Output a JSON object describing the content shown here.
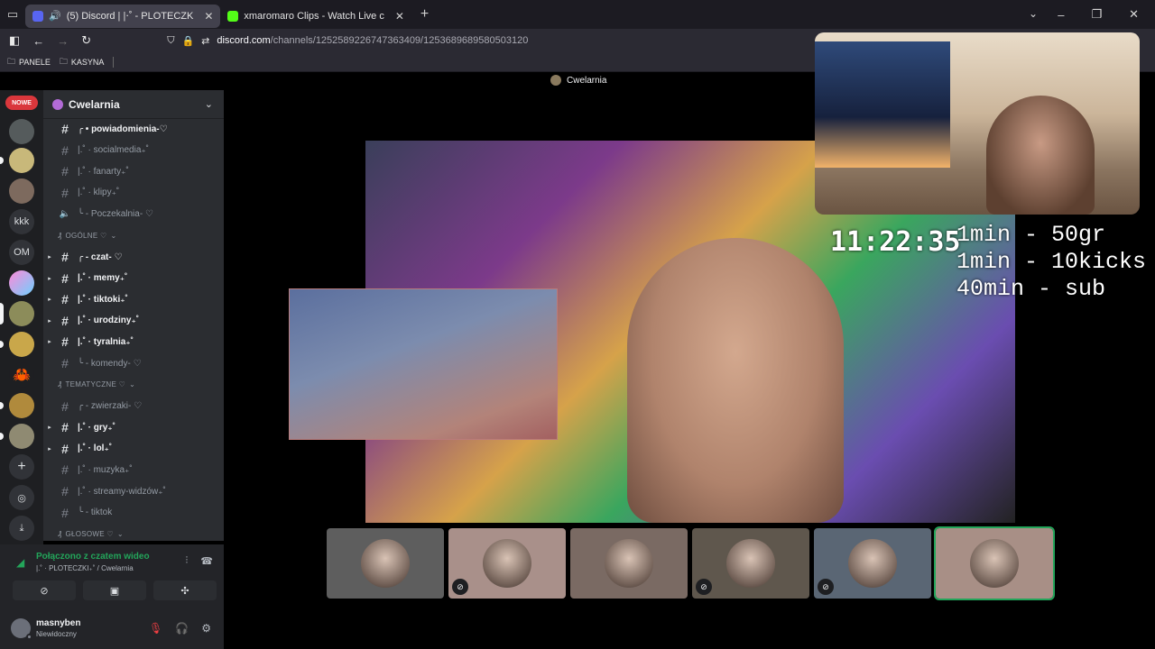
{
  "browser": {
    "tabs": [
      {
        "label": "(5) Discord | |‧˚ - PLOTECZK",
        "color": "#5865f2"
      },
      {
        "label": "xmaromaro Clips - Watch Live c",
        "color": "#53fc18"
      }
    ],
    "url_host": "discord.com",
    "url_path": "/channels/1252589226747363409/1253689689580503120",
    "bookmarks": [
      "PANELE",
      "KASYNA"
    ]
  },
  "servers": {
    "badge": "NOWE",
    "text_icons": [
      "kkk",
      "OM"
    ]
  },
  "guild": {
    "name": "Cwelarnia",
    "channels": [
      {
        "type": "text",
        "name": "╭ • powiadomienia-♡",
        "unread": true,
        "arrow": false
      },
      {
        "type": "text",
        "name": "|.˚ · socialmedia₊˚",
        "unread": false,
        "arrow": false
      },
      {
        "type": "text",
        "name": "|.˚ · fanarty₊˚",
        "unread": false,
        "arrow": false
      },
      {
        "type": "text",
        "name": "|.˚ · klipy₊˚",
        "unread": false,
        "arrow": false
      },
      {
        "type": "voice",
        "name": "╰ - Poczekalnia- ♡",
        "unread": false,
        "arrow": false
      },
      {
        "type": "category",
        "name": "OGÓLNE ♡"
      },
      {
        "type": "text",
        "name": "╭ - czat- ♡",
        "unread": true,
        "arrow": true
      },
      {
        "type": "text",
        "name": "|.˚ · memy₊˚",
        "unread": true,
        "arrow": true
      },
      {
        "type": "text",
        "name": "|.˚ · tiktoki₊˚",
        "unread": true,
        "arrow": true
      },
      {
        "type": "text",
        "name": "|.˚ · urodziny₊˚",
        "unread": true,
        "arrow": true
      },
      {
        "type": "text",
        "name": "|.˚ · tyralnia₊˚",
        "unread": true,
        "arrow": true
      },
      {
        "type": "text",
        "name": "╰ - komendy- ♡",
        "unread": false,
        "arrow": false
      },
      {
        "type": "category",
        "name": "TEMATYCZNE ♡"
      },
      {
        "type": "text",
        "name": "╭ - zwierzaki- ♡",
        "unread": false,
        "arrow": false
      },
      {
        "type": "text",
        "name": "|.˚ · gry₊˚",
        "unread": true,
        "arrow": true
      },
      {
        "type": "text",
        "name": "|.˚ · lol₊˚",
        "unread": true,
        "arrow": true
      },
      {
        "type": "text",
        "name": "|.˚ · muzyka₊˚",
        "unread": false,
        "arrow": false
      },
      {
        "type": "text",
        "name": "|.˚ · streamy-widzów₊˚",
        "unread": false,
        "arrow": false
      },
      {
        "type": "text",
        "name": "╰ - tiktok",
        "unread": false,
        "arrow": false
      },
      {
        "type": "category",
        "name": "GŁOSOWE ♡"
      }
    ]
  },
  "voice": {
    "status": "Połączono z czatem wideo",
    "location": "|.˚ · PLOTECZKI₊˚ / Cwelarnia"
  },
  "user": {
    "name": "masnyben",
    "status": "Niewidoczny"
  },
  "call": {
    "title": "Cwelarnia",
    "timer": "11:22:35",
    "price_lines": [
      "1min - 50gr",
      "1min - 10kicks",
      "40min - sub"
    ],
    "tiles": [
      {
        "bg": "#5e5e5e",
        "muted": false,
        "speaking": false
      },
      {
        "bg": "#a9908a",
        "muted": true,
        "speaking": false
      },
      {
        "bg": "#7a6a63",
        "muted": false,
        "speaking": false
      },
      {
        "bg": "#5f574d",
        "muted": true,
        "speaking": false
      },
      {
        "bg": "#5a6674",
        "muted": true,
        "speaking": false
      },
      {
        "bg": "#a88f86",
        "muted": false,
        "speaking": true
      }
    ]
  }
}
